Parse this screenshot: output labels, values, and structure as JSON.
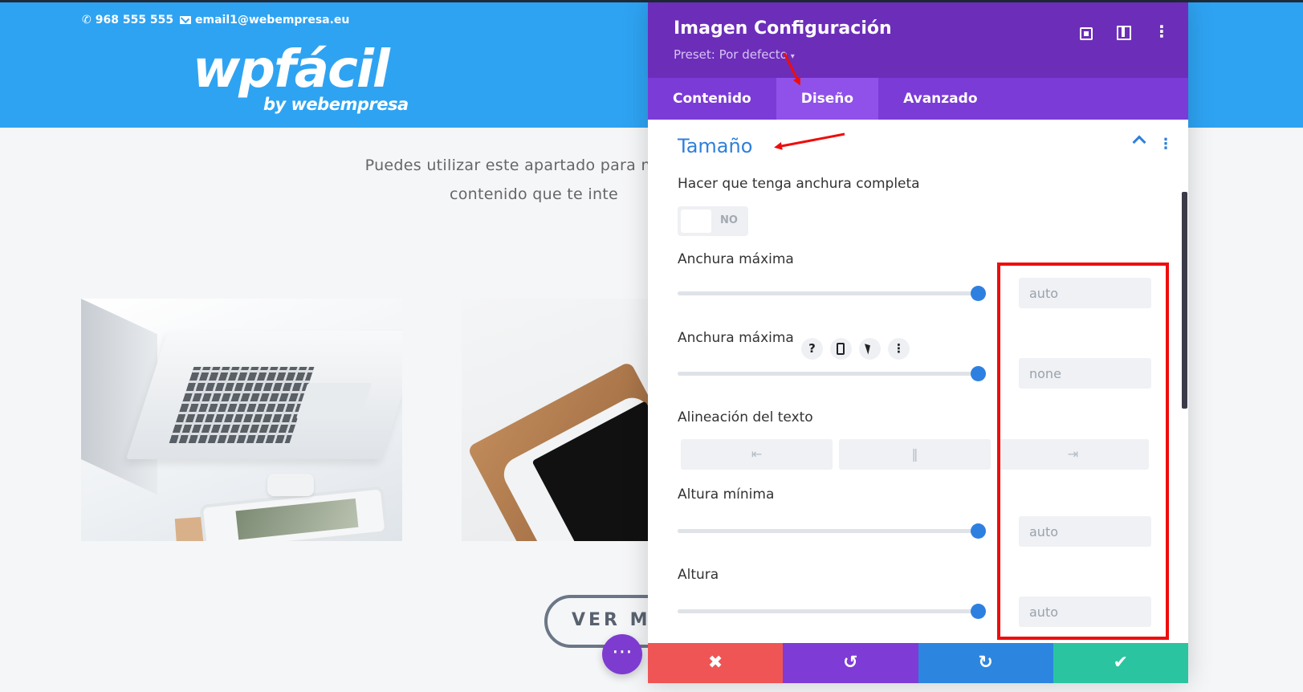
{
  "site": {
    "phone": "968 555 555",
    "phone_icon": "phone-icon",
    "email": "email1@webempresa.eu",
    "email_icon": "mail-icon",
    "logo_main": "wpfácil",
    "logo_sub": "by webempresa",
    "intro_line1": "Puedes utilizar este apartado para mostrar",
    "intro_line2": "contenido que te inte",
    "button_label": "VER MÁS",
    "fab_icon": "more-icon",
    "header_color": "#2ea3f2"
  },
  "modal": {
    "title": "Imagen Configuración",
    "preset": "Preset: Por defecto",
    "header_color": "#6c2eb9",
    "header_icons": [
      "focus-mode-icon",
      "split-view-icon",
      "more-options-icon"
    ],
    "tabs": [
      {
        "label": "Contenido",
        "active": false
      },
      {
        "label": "Diseño",
        "active": true
      },
      {
        "label": "Avanzado",
        "active": false
      }
    ],
    "section_title": "Tamaño",
    "fullwidth": {
      "label": "Hacer que tenga anchura completa",
      "value": "NO"
    },
    "fields": [
      {
        "label": "Anchura máxima",
        "value": "auto",
        "slider": 1.0
      },
      {
        "label": "Anchura máxima",
        "value": "none",
        "slider": 1.0
      },
      {
        "label": "Altura mínima",
        "value": "auto",
        "slider": 1.0
      },
      {
        "label": "Altura",
        "value": "auto",
        "slider": 1.0
      }
    ],
    "responsive_icons": [
      "help-icon",
      "phone-icon",
      "cursor-icon",
      "more-icon"
    ],
    "text_alignment": {
      "label": "Alineación del texto",
      "options": [
        "align-left-icon",
        "align-center-icon",
        "align-right-icon"
      ]
    },
    "footer": {
      "cancel_icon": "close-icon",
      "undo_icon": "undo-icon",
      "redo_icon": "redo-icon",
      "save_icon": "check-icon",
      "colors": [
        "#ef5555",
        "#7f3bd5",
        "#2c86e0",
        "#2bc4a0"
      ]
    }
  },
  "annotation_color": "#ee0d0d"
}
